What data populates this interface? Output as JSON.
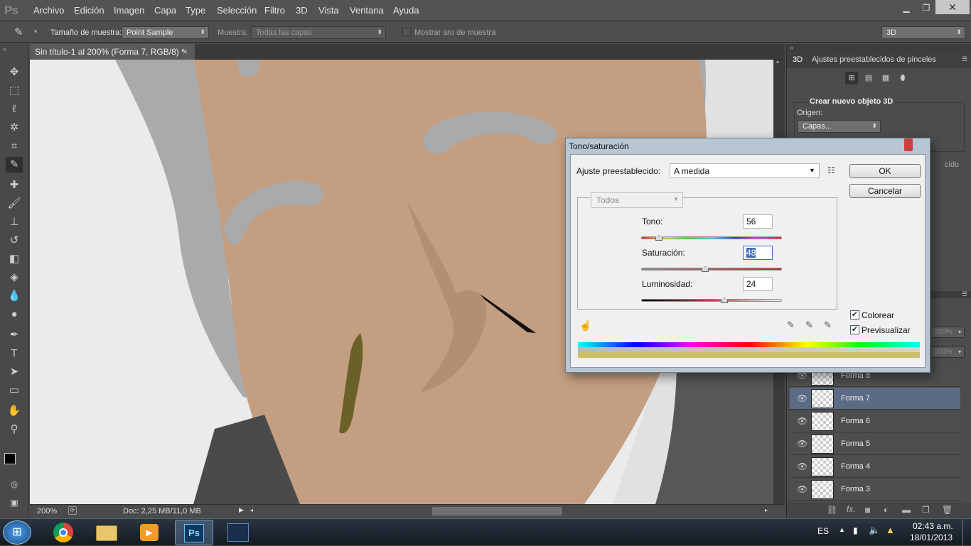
{
  "app": {
    "logo": "Ps"
  },
  "menu": [
    "Archivo",
    "Edición",
    "Imagen",
    "Capa",
    "Type",
    "Selección",
    "Filtro",
    "3D",
    "Vista",
    "Ventana",
    "Ayuda"
  ],
  "options": {
    "sample_size_label": "Tamaño de muestra:",
    "sample_size_value": "Point Sample",
    "sample_label": "Muestra:",
    "sample_value": "Todas las capas",
    "ring_label": "Mostrar aro de muestra",
    "workspace_value": "3D"
  },
  "document": {
    "tab_title": "Sin título-1 al 200% (Forma 7, RGB/8) *"
  },
  "status": {
    "zoom": "200%",
    "doc_info": "Doc: 2,25 MB/11,0 MB"
  },
  "panel3d": {
    "tab_3d": "3D",
    "tab_presets": "Ajustes preestablecidos de pinceles",
    "heading": "Crear nuevo objeto 3D",
    "origin_label": "Origen:",
    "origin_value": "Capas...",
    "partial_text": "cido"
  },
  "layers_panel": {
    "opacity_a": "100%",
    "opacity_b": "100%",
    "layers": [
      {
        "name": "Forma 8",
        "selected": false
      },
      {
        "name": "Forma 7",
        "selected": true
      },
      {
        "name": "Forma 6",
        "selected": false
      },
      {
        "name": "Forma 5",
        "selected": false
      },
      {
        "name": "Forma 4",
        "selected": false
      },
      {
        "name": "Forma 3",
        "selected": false
      }
    ]
  },
  "dialog": {
    "title": "Tono/saturación",
    "preset_label": "Ajuste preestablecido:",
    "preset_value": "A medida",
    "ok_label": "OK",
    "cancel_label": "Cancelar",
    "channel_value": "Todos",
    "hue_label": "Tono:",
    "hue_value": "56",
    "saturation_label": "Saturación:",
    "saturation_value": "48",
    "lightness_label": "Luminosidad:",
    "lightness_value": "24",
    "colorize_label": "Colorear",
    "colorize_checked": true,
    "preview_label": "Previsualizar",
    "preview_checked": true
  },
  "taskbar": {
    "language": "ES",
    "time": "02:43 a.m.",
    "date": "18/01/2013"
  },
  "icons": {
    "eyedropper": "eyedropper-icon",
    "move": "move-icon",
    "eye": "eye-icon"
  }
}
